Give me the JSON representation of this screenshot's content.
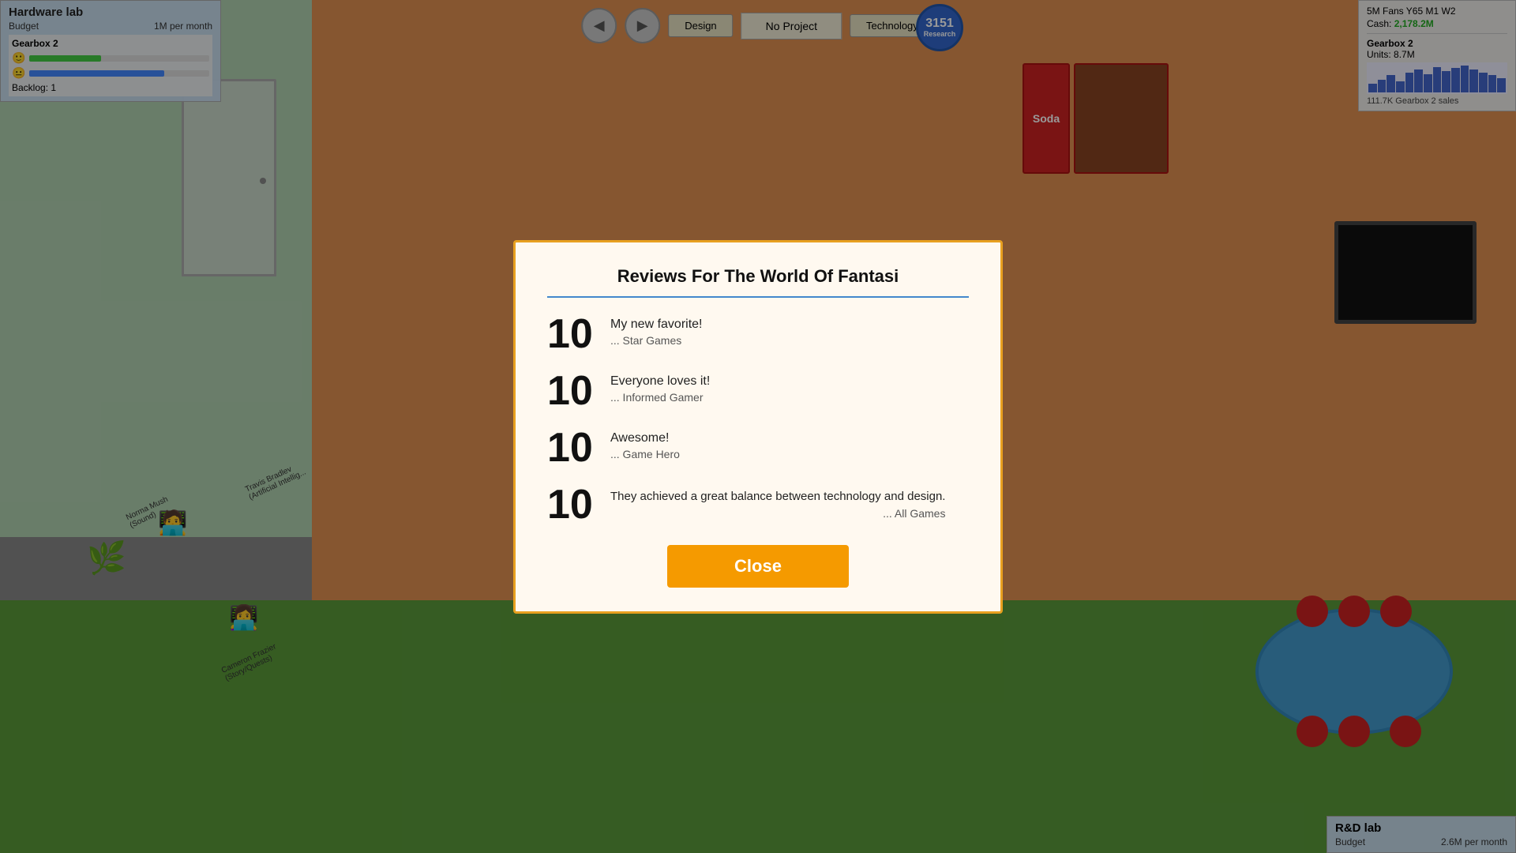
{
  "game": {
    "background_color": "#6aaa46"
  },
  "top_hud": {
    "hardware_lab": {
      "title": "Hardware lab",
      "budget_label": "Budget",
      "budget_value": "1M per month"
    },
    "gearbox_panel": {
      "title": "Gearbox 2",
      "backlog_label": "Backlog:",
      "backlog_value": "1"
    },
    "no_project_label": "No Project",
    "design_tab": "Design",
    "technology_tab": "Technology",
    "research_number": "3151",
    "research_label": "Research"
  },
  "right_stats": {
    "fans_label": "5M Fans Y65 M1 W2",
    "cash_label": "Cash:",
    "cash_value": "2,178.2M",
    "gearbox_title": "Gearbox 2",
    "units_label": "Units:",
    "units_value": "8.7M",
    "sales_footer": "111.7K  Gearbox 2 sales"
  },
  "rd_lab": {
    "title": "R&D lab",
    "budget_label": "Budget",
    "budget_value": "2.6M per month"
  },
  "modal": {
    "title": "Reviews For The World Of Fantasi",
    "reviews": [
      {
        "score": "10",
        "text": "My new favorite!",
        "source": "... Star Games"
      },
      {
        "score": "10",
        "text": "Everyone loves it!",
        "source": "... Informed Gamer"
      },
      {
        "score": "10",
        "text": "Awesome!",
        "source": "... Game Hero"
      },
      {
        "score": "10",
        "text": "They achieved a great balance between technology and design.",
        "source": "... All Games"
      }
    ],
    "close_button_label": "Close"
  },
  "workers": [
    {
      "name": "Travis Bradlev",
      "role": "(Artificial Intellig..."
    },
    {
      "name": "Norma Mush",
      "role": "(Sound)"
    },
    {
      "name": "Cameron Frazier",
      "role": "(Story/Quests)"
    }
  ]
}
